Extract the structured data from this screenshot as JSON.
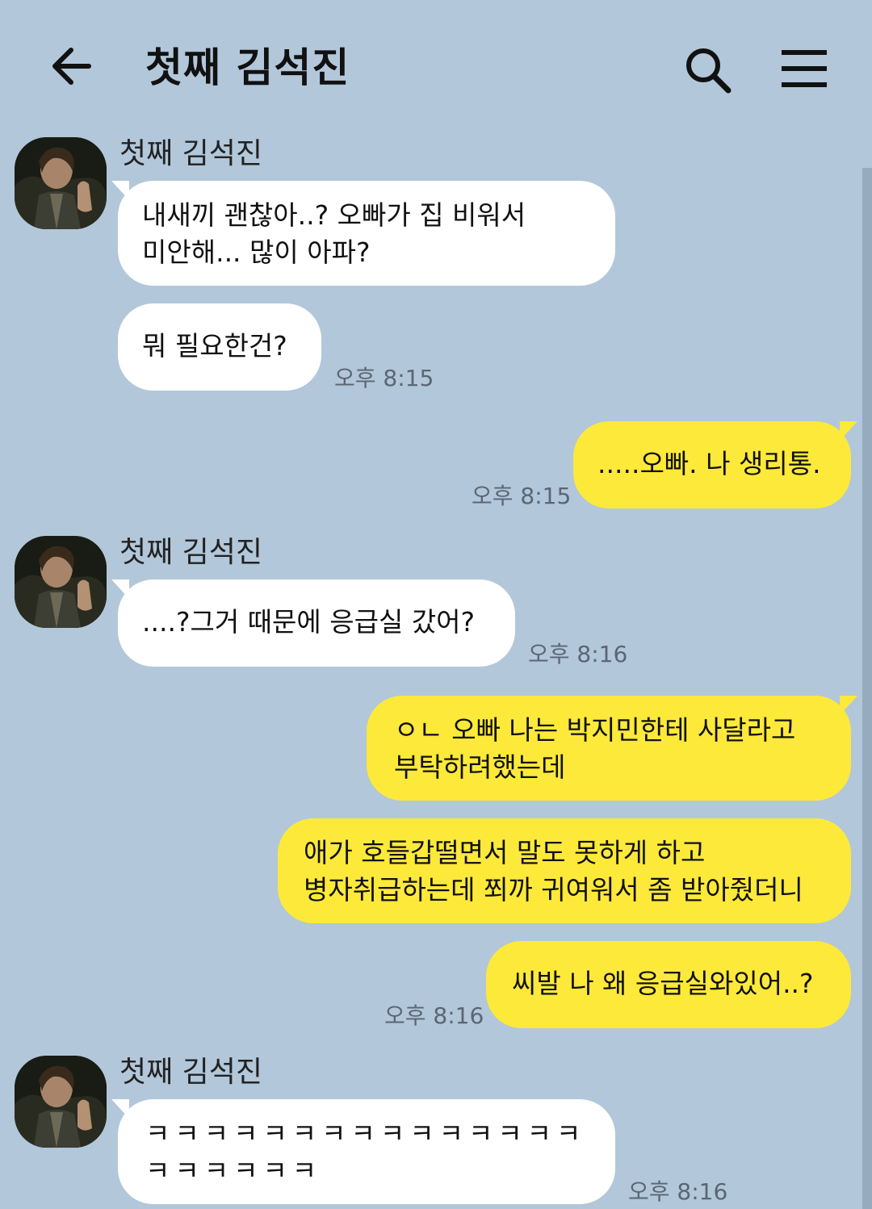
{
  "header": {
    "title": "첫째 김석진",
    "back_icon": "arrow-left-icon",
    "search_icon": "search-icon",
    "menu_icon": "hamburger-menu-icon"
  },
  "contact": {
    "name": "첫째 김석진"
  },
  "messages": [
    {
      "from": "them",
      "text": "내새끼 괜찮아..? 오빠가 집 비워서\n미안해... 많이 아파?",
      "time": ""
    },
    {
      "from": "them",
      "text": "뭐 필요한건?",
      "time": "오후 8:15"
    },
    {
      "from": "me",
      "text": ".....오빠. 나 생리통.",
      "time": "오후 8:15"
    },
    {
      "from": "them",
      "text": "....?그거 때문에 응급실 갔어?",
      "time": "오후 8:16"
    },
    {
      "from": "me",
      "text": "ㅇㄴ 오빠 나는 박지민한테 사달라고\n부탁하려했는데",
      "time": ""
    },
    {
      "from": "me",
      "text": "애가 호들갑떨면서 말도 못하게 하고\n병자취급하는데 쬐까 귀여워서 좀 받아줬더니",
      "time": ""
    },
    {
      "from": "me",
      "text": "씨발 나 왜 응급실와있어..?",
      "time": "오후 8:16"
    },
    {
      "from": "them",
      "text": "ㅋㅋㅋㅋㅋㅋㅋㅋㅋㅋㅋㅋㅋㅋㅋ\nㅋㅋㅋㅋㅋㅋ",
      "time": "오후 8:16"
    }
  ],
  "colors": {
    "background": "#b2c7da",
    "incoming_bubble": "#ffffff",
    "outgoing_bubble": "#fde93a",
    "timestamp": "#5a6674"
  }
}
